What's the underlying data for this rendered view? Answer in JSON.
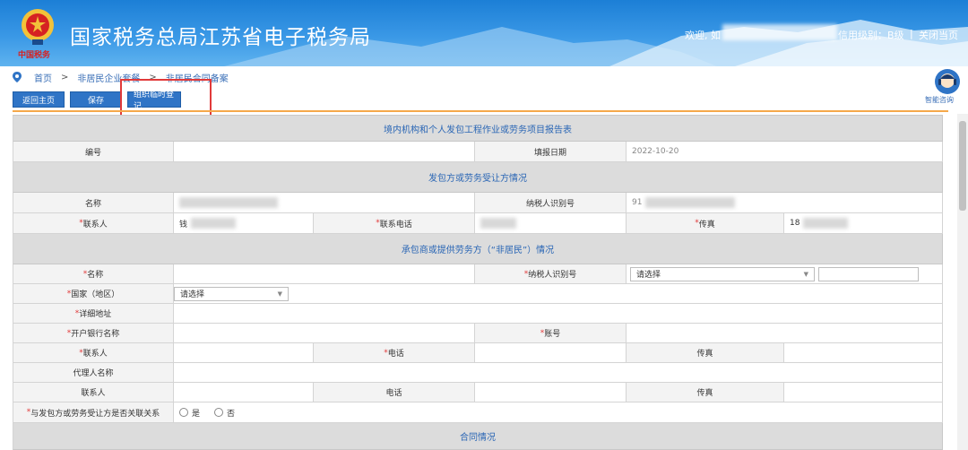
{
  "header": {
    "emblem_text": "中国税务",
    "site_title": "国家税务总局江苏省电子税务局",
    "welcome": "欢迎, 如",
    "credit_level": "信用级别：B级",
    "separator": "|",
    "close_page": "关闭当页",
    "colors": {
      "primary": "#1c7fd6"
    }
  },
  "assistant": {
    "label": "智能咨询"
  },
  "breadcrumb": {
    "items": [
      "首页",
      "非居民企业套餐",
      "非居民合同备案"
    ],
    "sep": ">"
  },
  "toolbar": {
    "home_label": "返回主页",
    "save_label": "保存",
    "temp_register_label": "组织临时登记"
  },
  "form": {
    "title": "境内机构和个人发包工程作业或劳务项目报告表",
    "row_number": {
      "label": "编号",
      "date_label": "填报日期",
      "date_value": "2022-10-20"
    },
    "contractor_section": "发包方或劳务受让方情况",
    "contractor": {
      "name_label": "名称",
      "tax_id_label": "纳税人识别号",
      "tax_id_prefix": "91",
      "contact_label": "联系人",
      "contact_prefix": "钱",
      "phone_label": "联系电话",
      "fax_label": "传真",
      "fax_prefix": "18"
    },
    "subcontractor_section": "承包商或提供劳务方（“非居民”）情况",
    "subcontractor": {
      "name_label": "名称",
      "tax_id_label": "纳税人识别号",
      "tax_id_select": "请选择",
      "country_label": "国家（地区）",
      "country_select": "请选择",
      "address_label": "详细地址",
      "bank_label": "开户银行名称",
      "account_label": "账号",
      "contact_label": "联系人",
      "phone_label": "电话",
      "fax_label": "传真",
      "agent_label": "代理人名称",
      "agent_contact_label": "联系人",
      "agent_phone_label": "电话",
      "agent_fax_label": "传真",
      "related_label": "与发包方或劳务受让方是否关联关系",
      "yes_label": "是",
      "no_label": "否"
    },
    "contract_section": "合同情况",
    "required_mark": "*"
  }
}
